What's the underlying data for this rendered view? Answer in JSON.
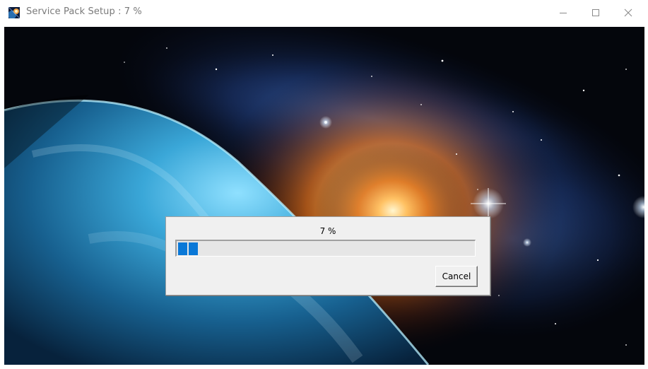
{
  "window": {
    "title": "Service Pack Setup : 7 %",
    "controls": {
      "minimize_icon": "minimize-icon",
      "maximize_icon": "maximize-icon",
      "close_icon": "close-icon"
    }
  },
  "dialog": {
    "percent_text": "7 %",
    "progress_percent": 7,
    "progress_color": "#0a78d7",
    "cancel_label": "Cancel"
  },
  "colors": {
    "titlebar_text": "#7a7a7a",
    "dialog_background": "#f0f0f0"
  }
}
